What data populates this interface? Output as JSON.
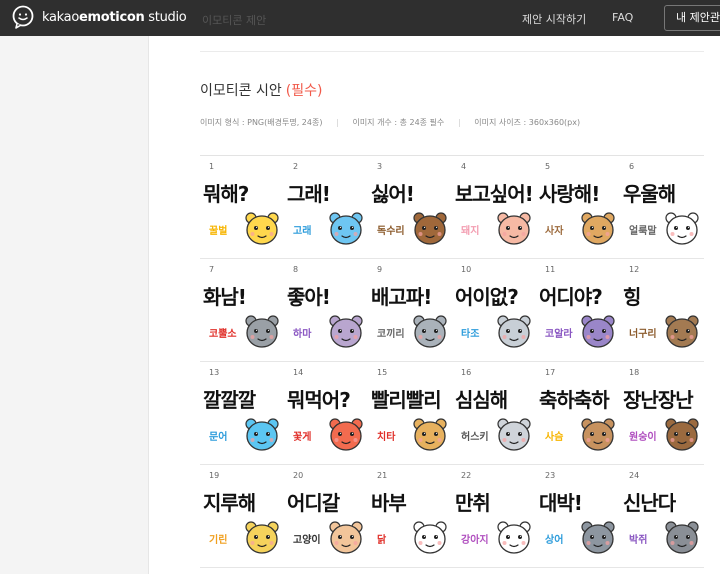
{
  "header": {
    "logo_text_a": "kakao",
    "logo_text_b": "emoticon",
    "logo_text_c": " studio",
    "faded_tab": "이모티콘 제안",
    "nav": {
      "propose": "제안 시작하기",
      "faq": "FAQ"
    },
    "mypage_button": "내 제안관리"
  },
  "section": {
    "title": "이모티콘 시안",
    "required": "(필수)"
  },
  "specs": {
    "format": "이미지 형식 : PNG(배경투명, 24종)",
    "count": "이미지 개수 : 총 24종 필수",
    "size": "이미지 사이즈 : 360x360(px)"
  },
  "emoticons": [
    {
      "n": "1",
      "big": "뭐해?",
      "small": "꿀벌",
      "color": "#f7b500",
      "animal": "bee",
      "body": "#ffd84d"
    },
    {
      "n": "2",
      "big": "그래!",
      "small": "고래",
      "color": "#2d9cdb",
      "animal": "whale",
      "body": "#6ec6f2"
    },
    {
      "n": "3",
      "big": "싫어!",
      "small": "독수리",
      "color": "#8b5a2b",
      "animal": "eagle",
      "body": "#a0683a"
    },
    {
      "n": "4",
      "big": "보고싶어!",
      "small": "돼지",
      "color": "#f39cb0",
      "animal": "pig",
      "body": "#f6b9a4"
    },
    {
      "n": "5",
      "big": "사랑해!",
      "small": "사자",
      "color": "#9c6a3c",
      "animal": "lion",
      "body": "#e0a861"
    },
    {
      "n": "6",
      "big": "우울해",
      "small": "얼룩말",
      "color": "#666666",
      "animal": "zebra",
      "body": "#ffffff"
    },
    {
      "n": "7",
      "big": "화남!",
      "small": "코뿔소",
      "color": "#e0302a",
      "animal": "rhino",
      "body": "#9aa0a6"
    },
    {
      "n": "8",
      "big": "좋아!",
      "small": "하마",
      "color": "#8a57c2",
      "animal": "hippo",
      "body": "#b9a6cf"
    },
    {
      "n": "9",
      "big": "배고파!",
      "small": "코끼리",
      "color": "#666666",
      "animal": "elephant",
      "body": "#aab2ba"
    },
    {
      "n": "10",
      "big": "어이없?",
      "small": "타조",
      "color": "#2d9cdb",
      "animal": "ostrich",
      "body": "#c8cfd6"
    },
    {
      "n": "11",
      "big": "어디야?",
      "small": "코알라",
      "color": "#8a57c2",
      "animal": "koala",
      "body": "#9a86c9"
    },
    {
      "n": "12",
      "big": "힝",
      "small": "너구리",
      "color": "#8b5a2b",
      "animal": "raccoon",
      "body": "#a37a52"
    },
    {
      "n": "13",
      "big": "깔깔깔",
      "small": "문어",
      "color": "#2d9cdb",
      "animal": "octopus",
      "body": "#5cc6f2"
    },
    {
      "n": "14",
      "big": "뭐먹어?",
      "small": "꽃게",
      "color": "#e0302a",
      "animal": "crab",
      "body": "#f26b4f"
    },
    {
      "n": "15",
      "big": "빨리빨리",
      "small": "치타",
      "color": "#e0302a",
      "animal": "cheetah",
      "body": "#e7b15e"
    },
    {
      "n": "16",
      "big": "심심해",
      "small": "허스키",
      "color": "#555555",
      "animal": "husky",
      "body": "#cfd4da"
    },
    {
      "n": "17",
      "big": "축하축하",
      "small": "사슴",
      "color": "#f7b500",
      "animal": "deer",
      "body": "#c7925f"
    },
    {
      "n": "18",
      "big": "장난장난",
      "small": "원숭이",
      "color": "#b04fbf",
      "animal": "monkey",
      "body": "#9b6a3f"
    },
    {
      "n": "19",
      "big": "지루해",
      "small": "기린",
      "color": "#f0a020",
      "animal": "giraffe",
      "body": "#f5d35c"
    },
    {
      "n": "20",
      "big": "어디갈",
      "small": "고양이",
      "color": "#333333",
      "animal": "cat",
      "body": "#f2c59a"
    },
    {
      "n": "21",
      "big": "바부",
      "small": "닭",
      "color": "#e0302a",
      "animal": "chicken",
      "body": "#ffffff"
    },
    {
      "n": "22",
      "big": "만취",
      "small": "강아지",
      "color": "#b04fbf",
      "animal": "puppy",
      "body": "#ffffff"
    },
    {
      "n": "23",
      "big": "대박!",
      "small": "상어",
      "color": "#2d9cdb",
      "animal": "shark",
      "body": "#8d96a0"
    },
    {
      "n": "24",
      "big": "신난다",
      "small": "박쥐",
      "color": "#8a57c2",
      "animal": "bat",
      "body": "#8a8f96"
    }
  ],
  "colors": {
    "header_bg": "#2f2f2f",
    "required": "#f15a4a",
    "sidebar_bg": "#f4f4f4"
  }
}
